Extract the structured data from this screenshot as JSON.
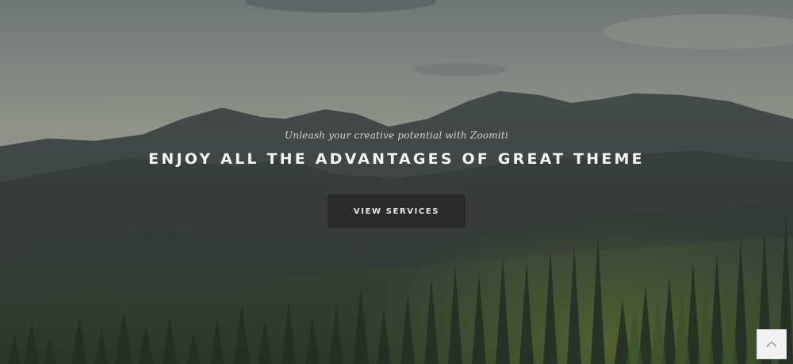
{
  "hero": {
    "tagline": "Unleash your creative potential with Zoomiti",
    "headline": "ENJOY ALL THE ADVANTAGES OF GREAT THEME",
    "cta_label": "VIEW SERVICES",
    "background": "misty-mountain-forest-photo"
  },
  "back_to_top": {
    "icon": "chevron-up-icon"
  },
  "colors": {
    "cta_background": "#2b2a2a",
    "headline_text": "#f4f5f2",
    "back_to_top_background": "#f1f2f1"
  }
}
